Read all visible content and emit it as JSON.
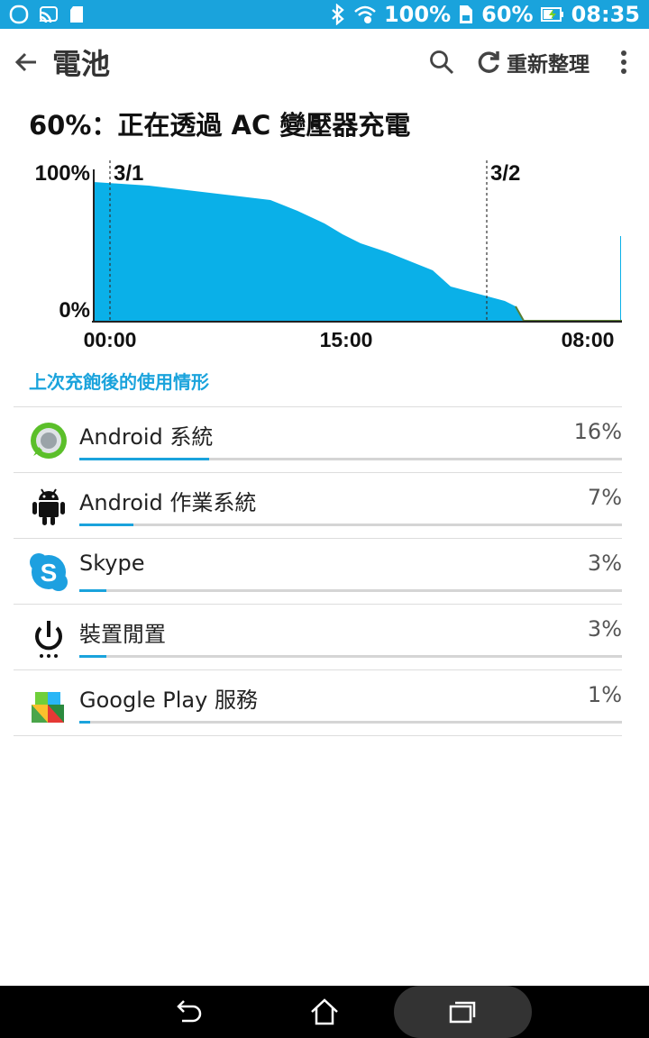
{
  "status_bar": {
    "wifi_signal_pct": "100%",
    "battery_pct": "60%",
    "time": "08:35",
    "icons": [
      "notification-circle-icon",
      "cast-icon",
      "sd-card-icon",
      "bluetooth-icon",
      "wifi-icon",
      "sim-icon",
      "charging-battery-icon"
    ]
  },
  "app_bar": {
    "title": "電池",
    "refresh_label": "重新整理"
  },
  "battery_status": "60%：正在透過 AC 變壓器充電",
  "chart_data": {
    "type": "area",
    "y_labels": [
      "100%",
      "0%"
    ],
    "x_tick_labels": [
      "00:00",
      "15:00",
      "08:00"
    ],
    "date_markers": [
      "3/1",
      "3/2"
    ],
    "color": "#0ab0e8",
    "ylim": [
      0,
      100
    ]
  },
  "usage_section_label": "上次充飽後的使用情形",
  "usage": [
    {
      "name": "Android 系統",
      "percent_label": "16%",
      "level": 0.24,
      "icon": "android-system-icon"
    },
    {
      "name": "Android 作業系統",
      "percent_label": "7%",
      "level": 0.1,
      "icon": "android-robot-icon"
    },
    {
      "name": "Skype",
      "percent_label": "3%",
      "level": 0.05,
      "icon": "skype-icon"
    },
    {
      "name": "裝置閒置",
      "percent_label": "3%",
      "level": 0.05,
      "icon": "power-icon"
    },
    {
      "name": "Google Play 服務",
      "percent_label": "1%",
      "level": 0.02,
      "icon": "google-play-services-icon"
    }
  ],
  "accent": "#1aa3dc"
}
